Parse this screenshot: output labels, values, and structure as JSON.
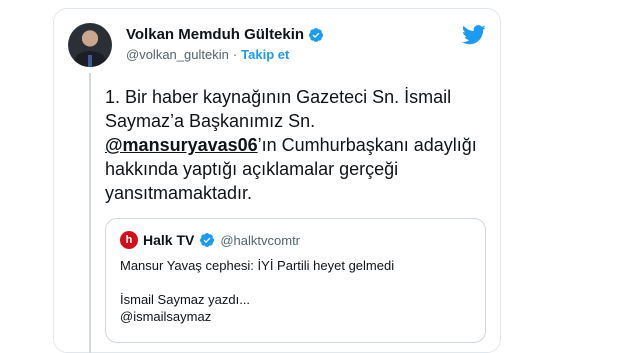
{
  "author": {
    "name": "Volkan Memduh Gültekin",
    "handle": "@volkan_gultekin",
    "separator": "·",
    "follow_label": "Takip et"
  },
  "tweet": {
    "text_before": "1. Bir haber kaynağının Gazeteci Sn. İsmail Saymaz’a Başkanımız Sn. ",
    "mention": "@mansuryavas06",
    "text_after": "’ın Cumhurbaşkanı adaylığı hakkında yaptığı açıklamalar gerçeği yansıtmamaktadır."
  },
  "quote": {
    "logo_letter": "h",
    "name": "Halk TV",
    "handle": "@halktvcomtr",
    "line1": "Mansur Yavaş cephesi: İYİ Partili heyet gelmedi",
    "line2": "İsmail Saymaz yazdı...",
    "line3": "@ismailsaymaz"
  },
  "colors": {
    "accent": "#1d9bf0",
    "verified": "#1d9bf0",
    "halktv_red": "#d1101e"
  },
  "icons": {
    "verified": "verified-badge-icon",
    "bird": "twitter-bird-icon"
  }
}
